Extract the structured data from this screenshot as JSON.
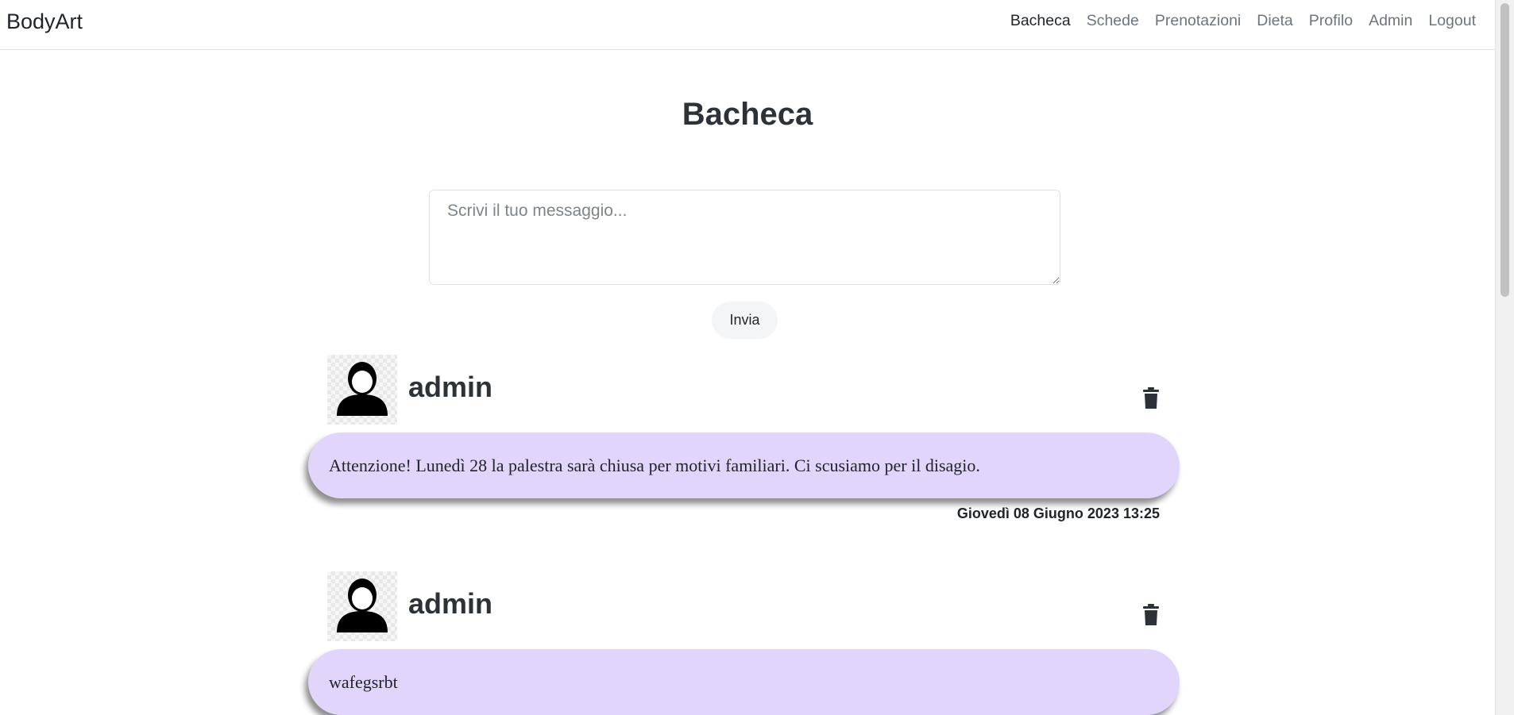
{
  "navbar": {
    "brand": "BodyArt",
    "links": [
      {
        "label": "Bacheca",
        "active": true
      },
      {
        "label": "Schede",
        "active": false
      },
      {
        "label": "Prenotazioni",
        "active": false
      },
      {
        "label": "Dieta",
        "active": false
      },
      {
        "label": "Profilo",
        "active": false
      },
      {
        "label": "Admin",
        "active": false
      },
      {
        "label": "Logout",
        "active": false
      }
    ]
  },
  "page": {
    "title": "Bacheca"
  },
  "composer": {
    "placeholder": "Scrivi il tuo messaggio...",
    "value": "",
    "send_label": "Invia"
  },
  "posts": [
    {
      "author": "admin",
      "message": "Attenzione! Lunedì 28 la palestra sarà chiusa per motivi familiari. Ci scusiamo per il disagio.",
      "timestamp": "Giovedì 08 Giugno 2023 13:25",
      "avatar_icon": "user-silhouette-icon",
      "delete_icon": "trash-icon"
    },
    {
      "author": "admin",
      "message": "wafegsrbt",
      "timestamp": "",
      "avatar_icon": "user-silhouette-icon",
      "delete_icon": "trash-icon"
    }
  ],
  "colors": {
    "bubble": "#e2d5fc",
    "text_dark": "#2d3238",
    "nav_inactive": "#6c757d"
  }
}
